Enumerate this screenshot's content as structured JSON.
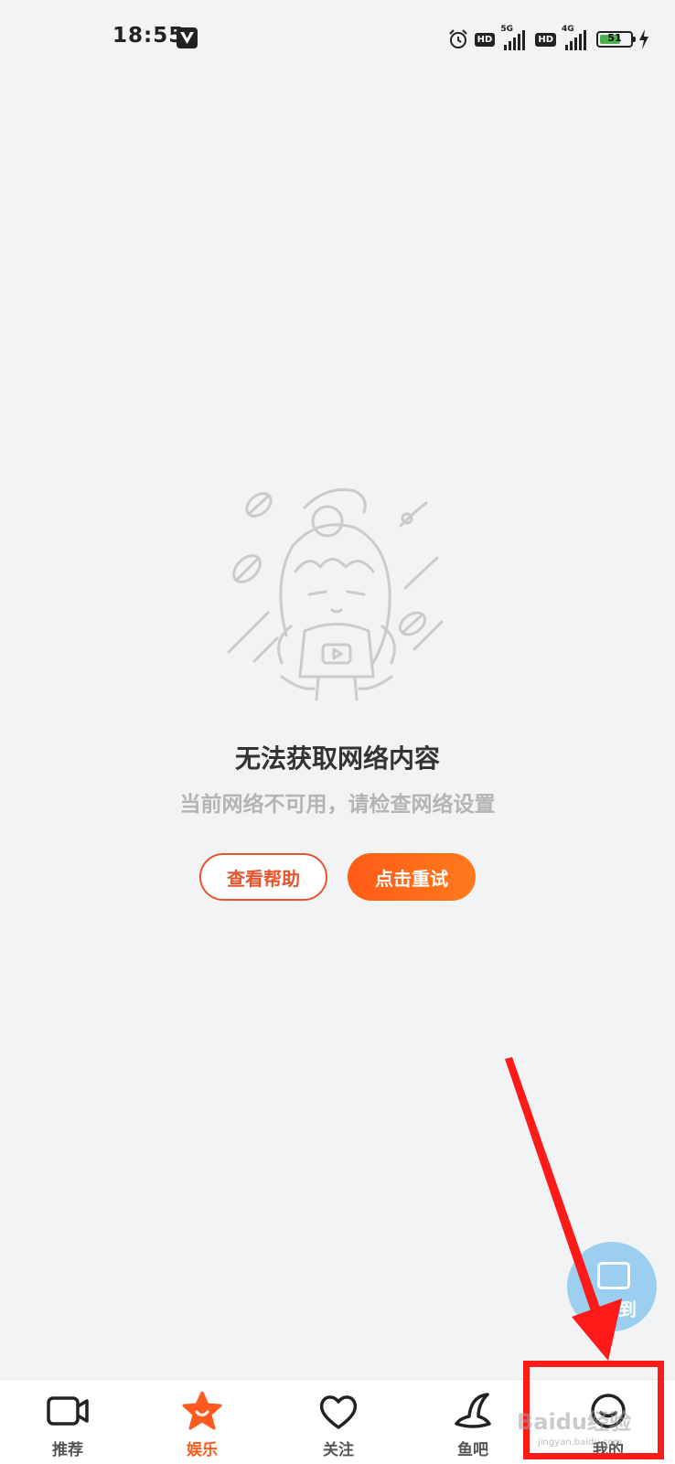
{
  "status_bar": {
    "time": "18:55",
    "net1": "5G",
    "net2": "4G",
    "hd": "HD",
    "battery_level": "51",
    "icons": [
      "alarm-icon",
      "hd-icon",
      "signal-icon",
      "battery-icon",
      "charging-icon"
    ]
  },
  "empty_state": {
    "title": "无法获取网络内容",
    "subtitle": "当前网络不可用，请检查网络设置",
    "help_button": "查看帮助",
    "retry_button": "点击重试"
  },
  "floating_sign": {
    "label": "到"
  },
  "tabs": [
    {
      "label": "推荐",
      "icon": "video-camera-icon",
      "active": false
    },
    {
      "label": "娱乐",
      "icon": "star-icon",
      "active": true
    },
    {
      "label": "关注",
      "icon": "heart-icon",
      "active": false
    },
    {
      "label": "鱼吧",
      "icon": "witch-hat-icon",
      "active": false
    },
    {
      "label": "我的",
      "icon": "smile-icon",
      "active": false
    }
  ],
  "watermark": {
    "text": "Baidu经验",
    "sub": "jingyan.baidu.com"
  },
  "colors": {
    "accent": "#ff5a1e",
    "annotation": "#ff1a1a"
  }
}
